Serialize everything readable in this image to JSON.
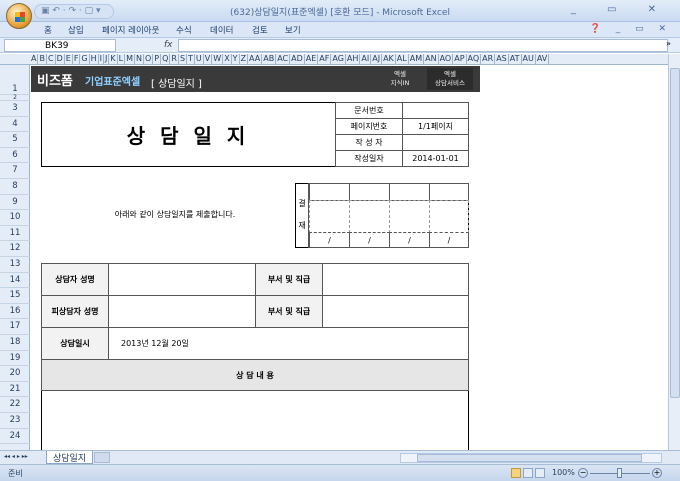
{
  "window": {
    "title": "(632)상담일지(표준엑셀) [호환 모드] - Microsoft Excel",
    "qat": "▣ ↶ · ↷ · ▢ ▾",
    "controls": "_ ▭ ✕"
  },
  "ribbon": {
    "tabs": [
      "홈",
      "삽입",
      "페이지 레이아웃",
      "수식",
      "데이터",
      "검토",
      "보기"
    ],
    "right": "❓ _ ▭ ✕"
  },
  "formula": {
    "cell_ref": "BK39",
    "fx": "fx",
    "value": "",
    "expand": "»"
  },
  "columns": [
    "A",
    "B",
    "C",
    "D",
    "E",
    "F",
    "G",
    "H",
    "I",
    "J",
    "K",
    "L",
    "M",
    "N",
    "O",
    "P",
    "Q",
    "R",
    "S",
    "T",
    "U",
    "V",
    "W",
    "X",
    "Y",
    "Z",
    "AA",
    "AB",
    "AC",
    "AD",
    "AE",
    "AF",
    "AG",
    "AH",
    "AI",
    "AJ",
    "AK",
    "AL",
    "AM",
    "AN",
    "AO",
    "AP",
    "AQ",
    "AR",
    "AS",
    "AT",
    "AU",
    "AV"
  ],
  "rows": [
    "1",
    "2",
    "3",
    "4",
    "5",
    "6",
    "7",
    "8",
    "9",
    "10",
    "11",
    "12",
    "13",
    "14",
    "15",
    "16",
    "17",
    "18",
    "19",
    "20",
    "21",
    "22",
    "23",
    "24"
  ],
  "banner": {
    "brand": "비즈폼",
    "brand_sub": "기업표준엑셀",
    "title": "[ 상담일지 ]",
    "btn1": [
      "엑셀",
      "지식IN"
    ],
    "btn2": [
      "엑셀",
      "상담서비스"
    ]
  },
  "form": {
    "title": "상 담 일 지",
    "info": [
      [
        "문서번호",
        ""
      ],
      [
        "페이지번호",
        "1/1페이지"
      ],
      [
        "작 성 자",
        ""
      ],
      [
        "작성일자",
        "2014-01-01"
      ]
    ],
    "notice": "아래와 같이 상담일지를 제출합니다.",
    "approval": {
      "label1": "결",
      "label2": "재",
      "slash": "/"
    },
    "counselor_label": "상담자 성명",
    "dept_label": "부서 및 직급",
    "counselee_label": "피상담자 성명",
    "dept_label2": "부서 및 직급",
    "date_label": "상담일시",
    "date_value": "2013년 12월 20일",
    "content_label": "상 담 내 용"
  },
  "sheets": {
    "nav": "◂◂ ◂ ▸ ▸▸",
    "active": "상담일지"
  },
  "status": {
    "ready": "준비",
    "zoom": "100%"
  }
}
